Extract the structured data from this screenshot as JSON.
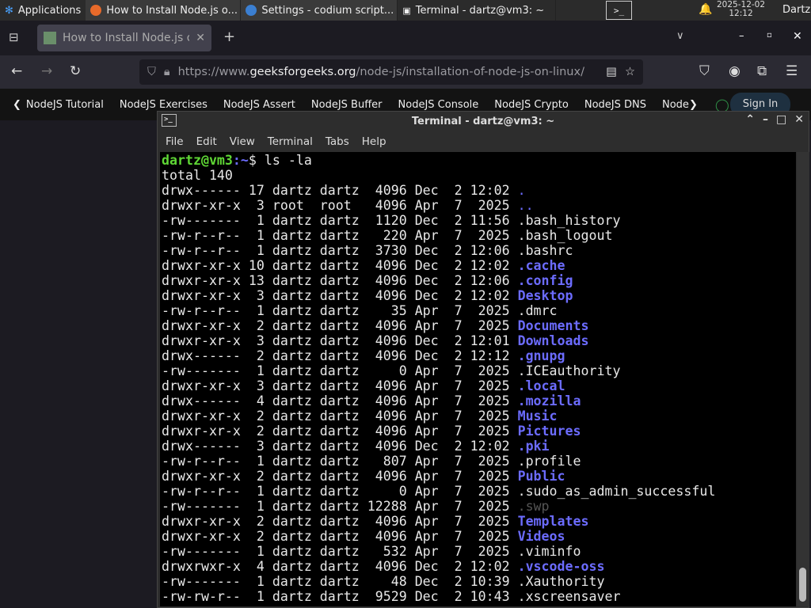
{
  "taskbar": {
    "apps": "Applications",
    "tasks": [
      "How to Install Node.js o...",
      "Settings - codium script...",
      "Terminal - dartz@vm3: ~"
    ],
    "date": "2025-12-02",
    "time": "12:12",
    "user": "Dartz"
  },
  "browser": {
    "tab_title": "How to Install Node.js or",
    "url_prefix": "https://www.",
    "url_domain": "geeksforgeeks.org",
    "url_path": "/node-js/installation-of-node-js-on-linux/",
    "bookmarks": [
      "NodeJS Tutorial",
      "NodeJS Exercises",
      "NodeJS Assert",
      "NodeJS Buffer",
      "NodeJS Console",
      "NodeJS Crypto",
      "NodeJS DNS",
      "Node"
    ],
    "sign_in": "Sign In"
  },
  "terminal": {
    "title": "Terminal - dartz@vm3: ~",
    "menu": [
      "File",
      "Edit",
      "View",
      "Terminal",
      "Tabs",
      "Help"
    ],
    "prompt_user": "dartz@vm3",
    "prompt_path": ":~",
    "prompt_sym": "$ ",
    "command": "ls -la",
    "total": "total 140",
    "rows": [
      [
        "drwx------ 17 dartz dartz  4096 Dec  2 12:02 ",
        ".",
        "b"
      ],
      [
        "drwxr-xr-x  3 root  root   4096 Apr  7  2025 ",
        "..",
        "b"
      ],
      [
        "-rw-------  1 dartz dartz  1120 Dec  2 11:56 ",
        ".bash_history",
        ""
      ],
      [
        "-rw-r--r--  1 dartz dartz   220 Apr  7  2025 ",
        ".bash_logout",
        ""
      ],
      [
        "-rw-r--r--  1 dartz dartz  3730 Dec  2 12:06 ",
        ".bashrc",
        ""
      ],
      [
        "drwxr-xr-x 10 dartz dartz  4096 Dec  2 12:02 ",
        ".cache",
        "bb"
      ],
      [
        "drwxr-xr-x 13 dartz dartz  4096 Dec  2 12:06 ",
        ".config",
        "bb"
      ],
      [
        "drwxr-xr-x  3 dartz dartz  4096 Dec  2 12:02 ",
        "Desktop",
        "bb"
      ],
      [
        "-rw-r--r--  1 dartz dartz    35 Apr  7  2025 ",
        ".dmrc",
        ""
      ],
      [
        "drwxr-xr-x  2 dartz dartz  4096 Apr  7  2025 ",
        "Documents",
        "bb"
      ],
      [
        "drwxr-xr-x  3 dartz dartz  4096 Dec  2 12:01 ",
        "Downloads",
        "bb"
      ],
      [
        "drwx------  2 dartz dartz  4096 Dec  2 12:12 ",
        ".gnupg",
        "bb"
      ],
      [
        "-rw-------  1 dartz dartz     0 Apr  7  2025 ",
        ".ICEauthority",
        ""
      ],
      [
        "drwxr-xr-x  3 dartz dartz  4096 Apr  7  2025 ",
        ".local",
        "bb"
      ],
      [
        "drwx------  4 dartz dartz  4096 Apr  7  2025 ",
        ".mozilla",
        "bb"
      ],
      [
        "drwxr-xr-x  2 dartz dartz  4096 Apr  7  2025 ",
        "Music",
        "bb"
      ],
      [
        "drwxr-xr-x  2 dartz dartz  4096 Apr  7  2025 ",
        "Pictures",
        "bb"
      ],
      [
        "drwx------  3 dartz dartz  4096 Dec  2 12:02 ",
        ".pki",
        "bb"
      ],
      [
        "-rw-r--r--  1 dartz dartz   807 Apr  7  2025 ",
        ".profile",
        ""
      ],
      [
        "drwxr-xr-x  2 dartz dartz  4096 Apr  7  2025 ",
        "Public",
        "bb"
      ],
      [
        "-rw-r--r--  1 dartz dartz     0 Apr  7  2025 ",
        ".sudo_as_admin_successful",
        ""
      ],
      [
        "-rw-------  1 dartz dartz 12288 Apr  7  2025 ",
        ".swp",
        "dim"
      ],
      [
        "drwxr-xr-x  2 dartz dartz  4096 Apr  7  2025 ",
        "Templates",
        "bb"
      ],
      [
        "drwxr-xr-x  2 dartz dartz  4096 Apr  7  2025 ",
        "Videos",
        "bb"
      ],
      [
        "-rw-------  1 dartz dartz   532 Apr  7  2025 ",
        ".viminfo",
        ""
      ],
      [
        "drwxrwxr-x  4 dartz dartz  4096 Dec  2 12:02 ",
        ".vscode-oss",
        "bb"
      ],
      [
        "-rw-------  1 dartz dartz    48 Dec  2 10:39 ",
        ".Xauthority",
        ""
      ],
      [
        "-rw-rw-r--  1 dartz dartz  9529 Dec  2 10:43 ",
        ".xscreensaver",
        ""
      ]
    ]
  }
}
